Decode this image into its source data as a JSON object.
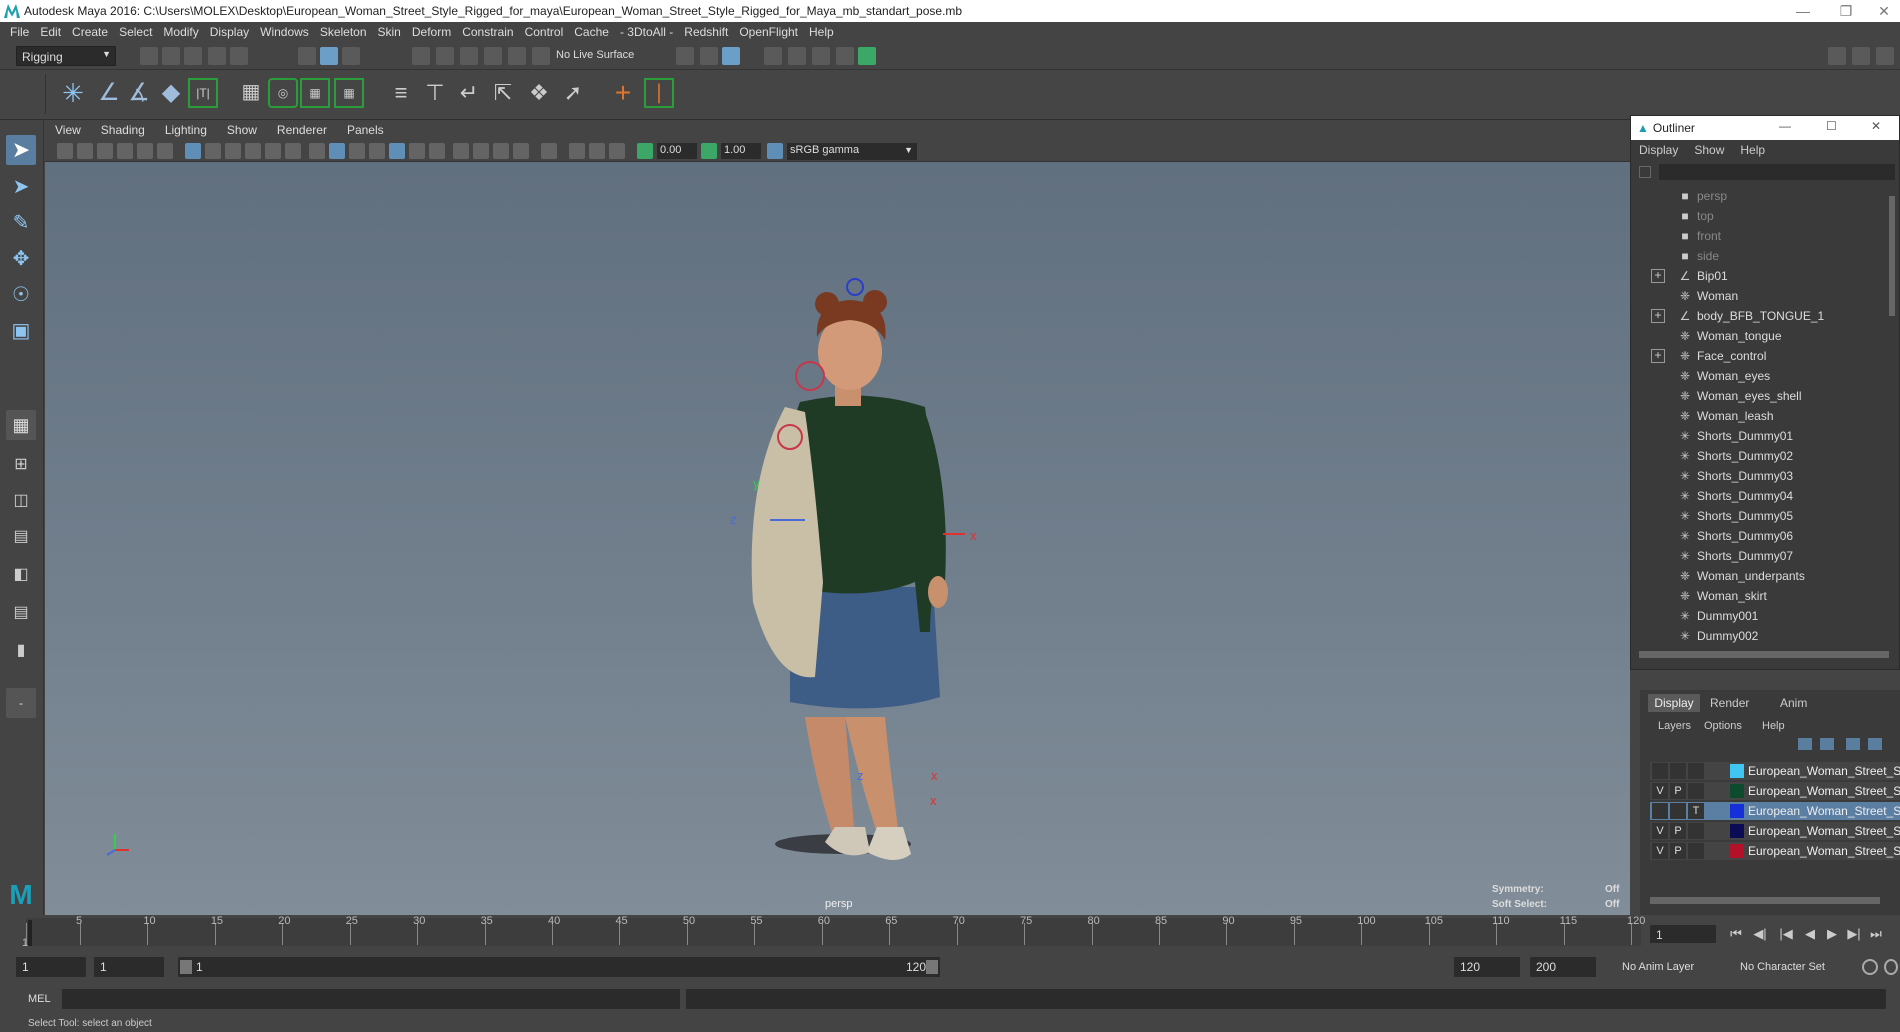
{
  "window": {
    "title": "Autodesk Maya 2016: C:\\Users\\MOLEX\\Desktop\\European_Woman_Street_Style_Rigged_for_maya\\European_Woman_Street_Style_Rigged_for_Maya_mb_standart_pose.mb"
  },
  "menubar": [
    "File",
    "Edit",
    "Create",
    "Select",
    "Modify",
    "Display",
    "Windows",
    "Skeleton",
    "Skin",
    "Deform",
    "Constrain",
    "Control",
    "Cache",
    "- 3DtoAll -",
    "Redshift",
    "OpenFlight",
    "Help"
  ],
  "status": {
    "menuset": "Rigging",
    "live_surface": "No Live Surface"
  },
  "viewport": {
    "menu": [
      "View",
      "Shading",
      "Lighting",
      "Show",
      "Renderer",
      "Panels"
    ],
    "near_value": "0.00",
    "far_value": "1.00",
    "color_space": "sRGB gamma",
    "camera_label": "persp",
    "symmetry_label": "Symmetry:",
    "symmetry_value": "Off",
    "soft_select_label": "Soft Select:",
    "soft_select_value": "Off",
    "axis_y": "y",
    "axis_z": "z",
    "axis_x": "x"
  },
  "outliner": {
    "title": "Outliner",
    "menu": [
      "Display",
      "Show",
      "Help"
    ],
    "items": [
      {
        "label": "persp",
        "icon": "camera-icon",
        "dim": true,
        "expand": false
      },
      {
        "label": "top",
        "icon": "camera-icon",
        "dim": true,
        "expand": false
      },
      {
        "label": "front",
        "icon": "camera-icon",
        "dim": true,
        "expand": false
      },
      {
        "label": "side",
        "icon": "camera-icon",
        "dim": true,
        "expand": false
      },
      {
        "label": "Bip01",
        "icon": "joint-icon",
        "dim": false,
        "expand": true
      },
      {
        "label": "Woman",
        "icon": "mesh-icon",
        "dim": false,
        "expand": false
      },
      {
        "label": "body_BFB_TONGUE_1",
        "icon": "joint-icon",
        "dim": false,
        "expand": true
      },
      {
        "label": "Woman_tongue",
        "icon": "mesh-icon",
        "dim": false,
        "expand": false
      },
      {
        "label": "Face_control",
        "icon": "mesh-icon",
        "dim": false,
        "expand": true
      },
      {
        "label": "Woman_eyes",
        "icon": "mesh-icon",
        "dim": false,
        "expand": false
      },
      {
        "label": "Woman_eyes_shell",
        "icon": "mesh-icon",
        "dim": false,
        "expand": false
      },
      {
        "label": "Woman_leash",
        "icon": "mesh-icon",
        "dim": false,
        "expand": false
      },
      {
        "label": "Shorts_Dummy01",
        "icon": "dummy-icon",
        "dim": false,
        "expand": false
      },
      {
        "label": "Shorts_Dummy02",
        "icon": "dummy-icon",
        "dim": false,
        "expand": false
      },
      {
        "label": "Shorts_Dummy03",
        "icon": "dummy-icon",
        "dim": false,
        "expand": false
      },
      {
        "label": "Shorts_Dummy04",
        "icon": "dummy-icon",
        "dim": false,
        "expand": false
      },
      {
        "label": "Shorts_Dummy05",
        "icon": "dummy-icon",
        "dim": false,
        "expand": false
      },
      {
        "label": "Shorts_Dummy06",
        "icon": "dummy-icon",
        "dim": false,
        "expand": false
      },
      {
        "label": "Shorts_Dummy07",
        "icon": "dummy-icon",
        "dim": false,
        "expand": false
      },
      {
        "label": "Woman_underpants",
        "icon": "mesh-icon",
        "dim": false,
        "expand": false
      },
      {
        "label": "Woman_skirt",
        "icon": "mesh-icon",
        "dim": false,
        "expand": false
      },
      {
        "label": "Dummy001",
        "icon": "dummy-icon",
        "dim": false,
        "expand": false
      },
      {
        "label": "Dummy002",
        "icon": "dummy-icon",
        "dim": false,
        "expand": false
      }
    ]
  },
  "layers_panel": {
    "tabs": [
      "Display",
      "Render",
      "Anim"
    ],
    "menu": [
      "Layers",
      "Options",
      "Help"
    ],
    "rows": [
      {
        "v": "",
        "p": "",
        "t": "",
        "color": "#3fc6f2",
        "name": "European_Woman_Street_Sty",
        "selected": false
      },
      {
        "v": "V",
        "p": "P",
        "t": "",
        "color": "#0d4a2e",
        "name": "European_Woman_Street_Sty",
        "selected": false
      },
      {
        "v": "",
        "p": "",
        "t": "T",
        "color": "#1530d8",
        "name": "European_Woman_Street_Style",
        "selected": true
      },
      {
        "v": "V",
        "p": "P",
        "t": "",
        "color": "#0b0c55",
        "name": "European_Woman_Street_Sty",
        "selected": false
      },
      {
        "v": "V",
        "p": "P",
        "t": "",
        "color": "#b3102a",
        "name": "European_Woman_Street_Sty",
        "selected": false
      }
    ]
  },
  "timeline": {
    "ticks": [
      "1",
      "5",
      "10",
      "15",
      "20",
      "25",
      "30",
      "35",
      "40",
      "45",
      "50",
      "55",
      "60",
      "65",
      "70",
      "75",
      "80",
      "85",
      "90",
      "95",
      "100",
      "105",
      "110",
      "115",
      "120"
    ],
    "current_frame": "1"
  },
  "range": {
    "start": "1",
    "playback_start": "1",
    "slider_start": "1",
    "slider_end": "120",
    "playback_end": "120",
    "end": "200",
    "anim_layer": "No Anim Layer",
    "char_set": "No Character Set"
  },
  "cmdline": {
    "label": "MEL"
  },
  "helpline": {
    "text": "Select Tool: select an object"
  }
}
